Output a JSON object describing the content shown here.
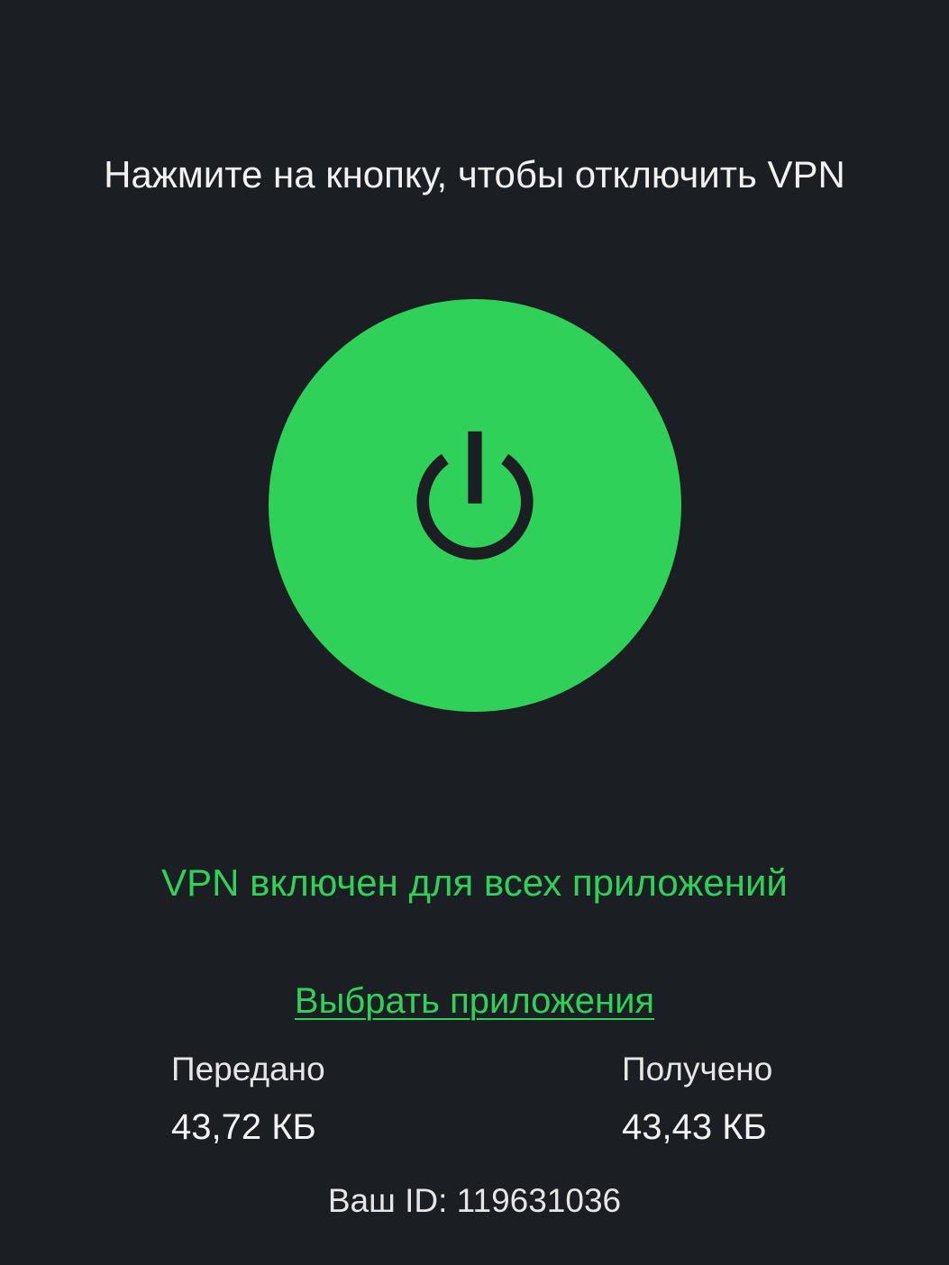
{
  "instruction": "Нажмите на кнопку, чтобы отключить VPN",
  "power_button": {
    "icon": "power-icon",
    "state": "on",
    "color": "#30d158",
    "icon_color": "#1b1e23"
  },
  "status": {
    "text": "VPN включен для всех приложений",
    "color": "#30d158"
  },
  "select_apps_link": "Выбрать приложения",
  "stats": {
    "sent": {
      "label": "Передано",
      "value": "43,72 КБ"
    },
    "received": {
      "label": "Получено",
      "value": "43,43 КБ"
    }
  },
  "user_id": "Ваш ID: 119631036",
  "colors": {
    "background": "#1b1e23",
    "accent": "#30d158"
  }
}
